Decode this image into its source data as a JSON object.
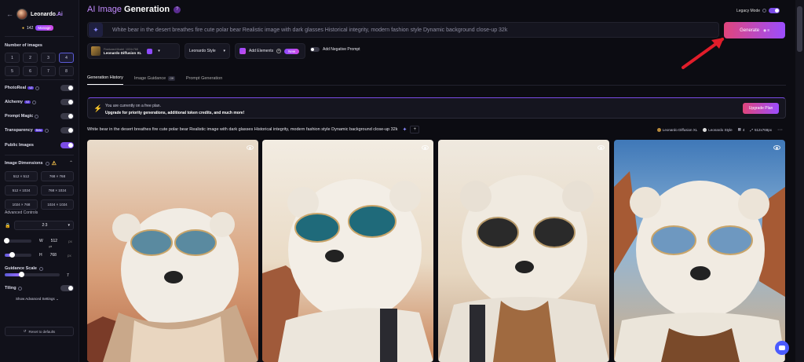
{
  "app": {
    "brand": "Leonardo",
    "brand_suffix": ".Ai",
    "tokens": "142",
    "manage_label": "Manage"
  },
  "sidebar": {
    "num_images_title": "Number of images",
    "num_options": [
      "1",
      "2",
      "3",
      "4",
      "5",
      "6",
      "7",
      "8"
    ],
    "selected_num": "4",
    "toggles": [
      {
        "label": "PhotoReal",
        "tag": "V2",
        "state": "off"
      },
      {
        "label": "Alchemy",
        "tag": "V2",
        "state": "off"
      },
      {
        "label": "Prompt Magic",
        "tag": "",
        "state": "off"
      },
      {
        "label": "Transparency",
        "tag": "Beta",
        "state": "off"
      },
      {
        "label": "Public Images",
        "tag": "",
        "state": "on"
      }
    ],
    "dimensions_title": "Image Dimensions",
    "dimensions": [
      "512 × 512",
      "768 × 768",
      "512 × 1024",
      "768 × 1024",
      "1024 × 768",
      "1024 × 1024"
    ],
    "advanced_controls_label": "Advanced Controls",
    "aspect_ratio": "2:3",
    "width_label": "W",
    "width_value": "512",
    "height_label": "H",
    "height_value": "768",
    "px_unit": "px",
    "guidance_title": "Guidance Scale",
    "guidance_value": "7",
    "tiling_label": "Tiling",
    "show_advanced": "Show Advanced Settings",
    "reset_label": "Reset to defaults"
  },
  "header": {
    "title_part1": "AI Image",
    "title_part2": "Generation",
    "legacy_mode": "Legacy Mode"
  },
  "prompt": {
    "text": "White bear in the desert breathes fire cute polar bear Realistic image with dark glasses Historical integrity, modern fashion style Dynamic background close-up 32k",
    "generate_label": "Generate",
    "generate_cost": "8"
  },
  "controls": {
    "model_key": "Finetuned Model",
    "model_dims": "1024×768",
    "model_name": "Leonardo Diffusion XL",
    "style": "Leonardo Style",
    "add_elements": "Add Elements",
    "new_badge": "New",
    "negative_prompt": "Add Negative Prompt"
  },
  "tabs": [
    {
      "label": "Generation History",
      "badge": ""
    },
    {
      "label": "Image Guidance",
      "badge": "Off"
    },
    {
      "label": "Prompt Generation",
      "badge": ""
    }
  ],
  "plan_banner": {
    "line1": "You are currently on a free plan.",
    "line2": "Upgrade for priority generations, additional token credits, and much more!",
    "button": "Upgrade Plan"
  },
  "generation": {
    "prompt": "White bear in the desert breathes fire cute polar bear Realistic image with dark glasses Historical integrity, modern fashion style Dynamic background close-up 32k",
    "meta_model": "Leonardo Diffusion XL",
    "meta_style": "Leonardo Style",
    "meta_count": "4",
    "meta_dims": "512x768px",
    "more": "···"
  }
}
